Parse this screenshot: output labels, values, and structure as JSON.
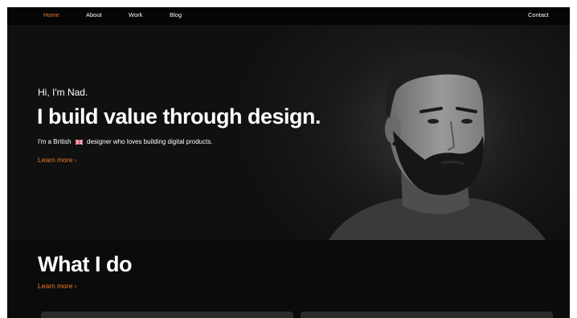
{
  "nav": {
    "items": [
      {
        "label": "Home",
        "active": true
      },
      {
        "label": "About",
        "active": false
      },
      {
        "label": "Work",
        "active": false
      },
      {
        "label": "Blog",
        "active": false
      }
    ],
    "contact": "Contact"
  },
  "hero": {
    "greeting": "Hi, I'm Nad.",
    "title": "I build value through design.",
    "subtitle_before": "I'm a British",
    "subtitle_after": "designer who loves building digital products.",
    "flag_icon": "uk-flag-icon",
    "learn_more": "Learn more",
    "chevron": "›"
  },
  "what_i_do": {
    "title": "What I do",
    "learn_more": "Learn more",
    "chevron": "›"
  },
  "colors": {
    "accent": "#f07a2a",
    "background": "#0b0b0b",
    "text": "#ffffff"
  }
}
